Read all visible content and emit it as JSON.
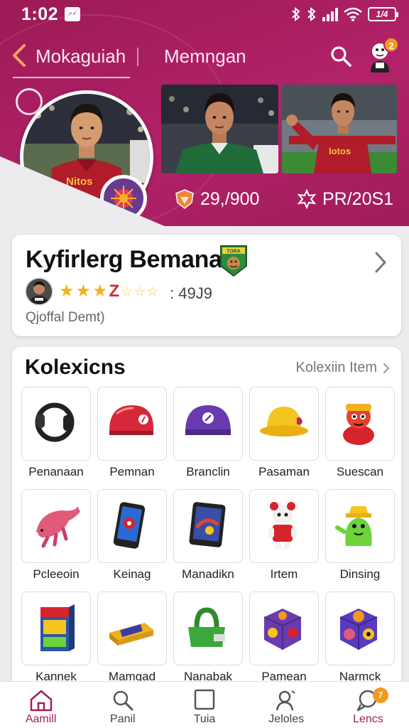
{
  "status_bar": {
    "time": "1:02",
    "battery": "1/4"
  },
  "nav": {
    "back_title": "Mokaguiah",
    "tab": "Memngan",
    "notification_count": "2"
  },
  "player": {
    "jersey_text": "Nitos",
    "card2_jersey": "Iotos",
    "stats": [
      {
        "icon": "shield-badge-icon",
        "value": "29,/900"
      },
      {
        "icon": "star-burst-icon",
        "value": "PR/20S1"
      }
    ]
  },
  "profile": {
    "name": "Kyfirlerg Bemana",
    "team_logo_text": "TORA",
    "rating_text": ": 49J9",
    "subtitle": "Qjoffal Demt)",
    "stars_full": 3,
    "stars_half": 1,
    "stars_outline": 3
  },
  "collections": {
    "title": "Kolexicns",
    "link_label": "Kolexiin Item",
    "items": [
      {
        "label": "Penanaan",
        "icon": "ring-icon"
      },
      {
        "label": "Pemnan",
        "icon": "red-helmet-icon"
      },
      {
        "label": "Branclin",
        "icon": "purple-helmet-icon"
      },
      {
        "label": "Pasaman",
        "icon": "yellow-hat-icon"
      },
      {
        "label": "Suescan",
        "icon": "red-toy-icon"
      },
      {
        "label": "Pcleeoin",
        "icon": "pink-toy-icon"
      },
      {
        "label": "Keinag",
        "icon": "phone-icon"
      },
      {
        "label": "Manadikn",
        "icon": "tablet-icon"
      },
      {
        "label": "Irtem",
        "icon": "robot-figure-icon"
      },
      {
        "label": "Dinsing",
        "icon": "green-figure-icon"
      },
      {
        "label": "Kannek",
        "icon": "box-icon"
      },
      {
        "label": "Mamgad",
        "icon": "cartridge-icon"
      },
      {
        "label": "Nanabak",
        "icon": "green-bag-icon"
      },
      {
        "label": "Pamean",
        "icon": "purple-cube-icon"
      },
      {
        "label": "Narmck",
        "icon": "colorful-cube-icon"
      }
    ]
  },
  "bottom_nav": {
    "items": [
      {
        "label": "Aamill",
        "icon": "home-icon",
        "active": true
      },
      {
        "label": "Panil",
        "icon": "search-icon"
      },
      {
        "label": "Tuia",
        "icon": "square-icon"
      },
      {
        "label": "Jeloles",
        "icon": "profile-icon"
      },
      {
        "label": "Lencs",
        "icon": "chat-icon"
      }
    ],
    "badge": "7"
  },
  "colors": {
    "brand": "#b3226a",
    "accent_orange": "#f29a1c",
    "star": "#f2b21b"
  }
}
